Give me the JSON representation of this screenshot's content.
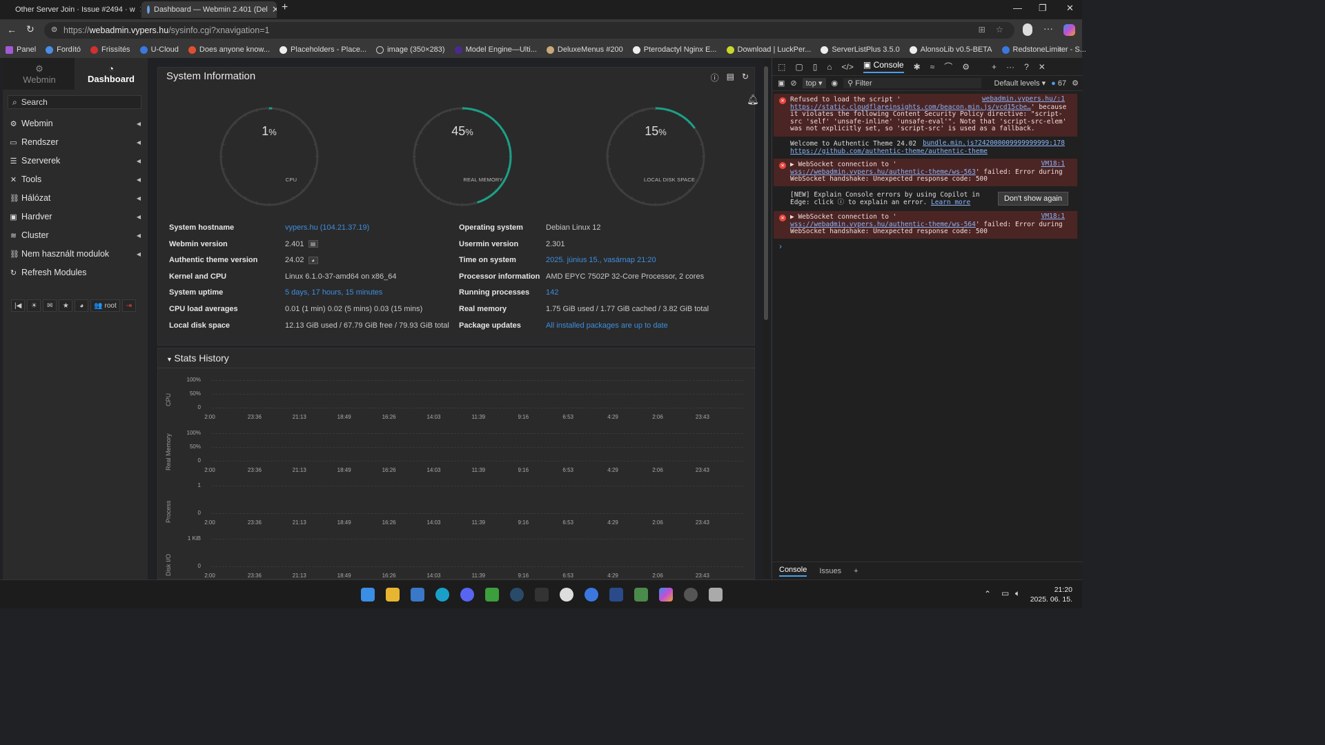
{
  "browser": {
    "tabs": [
      {
        "title": "Other Server Join · Issue #2494 · w"
      },
      {
        "title": "Dashboard — Webmin 2.401 (Del"
      }
    ],
    "url_host": "webadmin.vypers.hu",
    "url_prefix": "https://",
    "url_path": "/sysinfo.cgi?xnavigation=1",
    "bookmarks": [
      "Panel",
      "Fordító",
      "Frissítés",
      "U-Cloud",
      "Does anyone know...",
      "Placeholders - Place...",
      "image (350×283)",
      "Model Engine—Ulti...",
      "DeluxeMenus #200",
      "Pterodactyl Nginx E...",
      "Download | LuckPer...",
      "ServerListPlus 3.5.0",
      "AlonsoLib v0.5-BETA",
      "RedstoneLimiter - S..."
    ]
  },
  "sidebar": {
    "tab_webmin": "Webmin",
    "tab_dashboard": "Dashboard",
    "search_placeholder": "Search",
    "items": [
      {
        "label": "Webmin",
        "icon": "gear-icon"
      },
      {
        "label": "Rendszer",
        "icon": "monitor-icon"
      },
      {
        "label": "Szerverek",
        "icon": "server-icon"
      },
      {
        "label": "Tools",
        "icon": "tools-icon"
      },
      {
        "label": "Hálózat",
        "icon": "network-icon"
      },
      {
        "label": "Hardver",
        "icon": "hardware-icon"
      },
      {
        "label": "Cluster",
        "icon": "cluster-icon"
      },
      {
        "label": "Nem használt modulok",
        "icon": "modules-icon"
      },
      {
        "label": "Refresh Modules",
        "icon": "refresh-icon"
      }
    ],
    "user": "root"
  },
  "sysinfo": {
    "title": "System Information",
    "gauges": [
      {
        "value": "1",
        "unit": "%",
        "label": "CPU",
        "fraction": 0.01
      },
      {
        "value": "45",
        "unit": "%",
        "label": "REAL MEMORY",
        "fraction": 0.45
      },
      {
        "value": "15",
        "unit": "%",
        "label": "LOCAL DISK SPACE",
        "fraction": 0.15
      }
    ],
    "left": [
      {
        "k": "System hostname",
        "v": "vypers.hu (104.21.37.19)",
        "link": true
      },
      {
        "k": "Webmin version",
        "v": "2.401"
      },
      {
        "k": "Authentic theme version",
        "v": "24.02"
      },
      {
        "k": "Kernel and CPU",
        "v": "Linux 6.1.0-37-amd64 on x86_64"
      },
      {
        "k": "System uptime",
        "v": "5 days, 17 hours, 15 minutes",
        "link": true
      },
      {
        "k": "CPU load averages",
        "v": "0.01 (1 min) 0.02 (5 mins) 0.03 (15 mins)"
      },
      {
        "k": "Local disk space",
        "v": "12.13 GiB used / 67.79 GiB free / 79.93 GiB total"
      }
    ],
    "right": [
      {
        "k": "Operating system",
        "v": "Debian Linux 12"
      },
      {
        "k": "Usermin version",
        "v": "2.301"
      },
      {
        "k": "Time on system",
        "v": "2025. június 15., vasárnap 21:20",
        "link": true
      },
      {
        "k": "Processor information",
        "v": "AMD EPYC 7502P 32-Core Processor, 2 cores"
      },
      {
        "k": "Running processes",
        "v": "142",
        "link": true
      },
      {
        "k": "Real memory",
        "v": "1.75 GiB used / 1.77 GiB cached / 3.82 GiB total"
      },
      {
        "k": "Package updates",
        "v": "All installed packages are up to date",
        "link": true
      }
    ]
  },
  "stats": {
    "title": "Stats History",
    "xticks": [
      "2:00",
      "23:36",
      "21:13",
      "18:49",
      "16:26",
      "14:03",
      "11:39",
      "9:16",
      "6:53",
      "4:29",
      "2:06",
      "23:43"
    ],
    "charts": [
      {
        "label": "CPU",
        "yticks": [
          "100%",
          "50%",
          "0"
        ]
      },
      {
        "label": "Real Memory",
        "yticks": [
          "100%",
          "50%",
          "0"
        ]
      },
      {
        "label": "Process",
        "yticks": [
          "1",
          "0"
        ]
      },
      {
        "label": "Disk I/O",
        "yticks": [
          "1 KiB",
          "0"
        ]
      }
    ]
  },
  "devtools": {
    "tab_console": "Console",
    "context": "top",
    "filter": "Filter",
    "levels": "Default levels",
    "count": "67",
    "m1a": "Refused to load the script '",
    "m1src": "webadmin.vypers.hu/:1",
    "m1url": "https://static.cloudflareinsights.com/beacon.min.js/vcd15cbe…",
    "m1b": "' because it violates the following Content Security Policy directive: \"script-src 'self' 'unsafe-inline' 'unsafe-eval'\". Note that 'script-src-elem' was not explicitly set, so 'script-src' is used as a fallback.",
    "m2": "Welcome to Authentic Theme 24.02",
    "m2src": "bundle.min.js?242000009999999999:178",
    "m2url": "https://github.com/authentic-theme/authentic-theme",
    "m3a": "WebSocket connection to '",
    "m3src": "VM18:1",
    "m3url": "wss://webadmin.vypers.hu/authentic-theme/ws-563",
    "m3b": "' failed: Error during WebSocket handshake: Unexpected response code: 500",
    "m4": "[NEW] Explain Console errors by using Copilot in Edge: click",
    "m4b": "to explain an error.",
    "m4link": "Learn more",
    "dont_show": "Don't show again",
    "m5a": "WebSocket connection to '",
    "m5src": "VM18:1",
    "m5url": "wss://webadmin.vypers.hu/authentic-theme/ws-564",
    "m5b": "' failed: Error during WebSocket handshake: Unexpected response code: 500",
    "bottom_console": "Console",
    "bottom_issues": "Issues"
  },
  "taskbar": {
    "time": "21:20",
    "date": "2025. 06. 15."
  },
  "colors": {
    "accent": "#3d8fe0",
    "gauge": "#1aa188",
    "error_bg": "#4b2524"
  }
}
